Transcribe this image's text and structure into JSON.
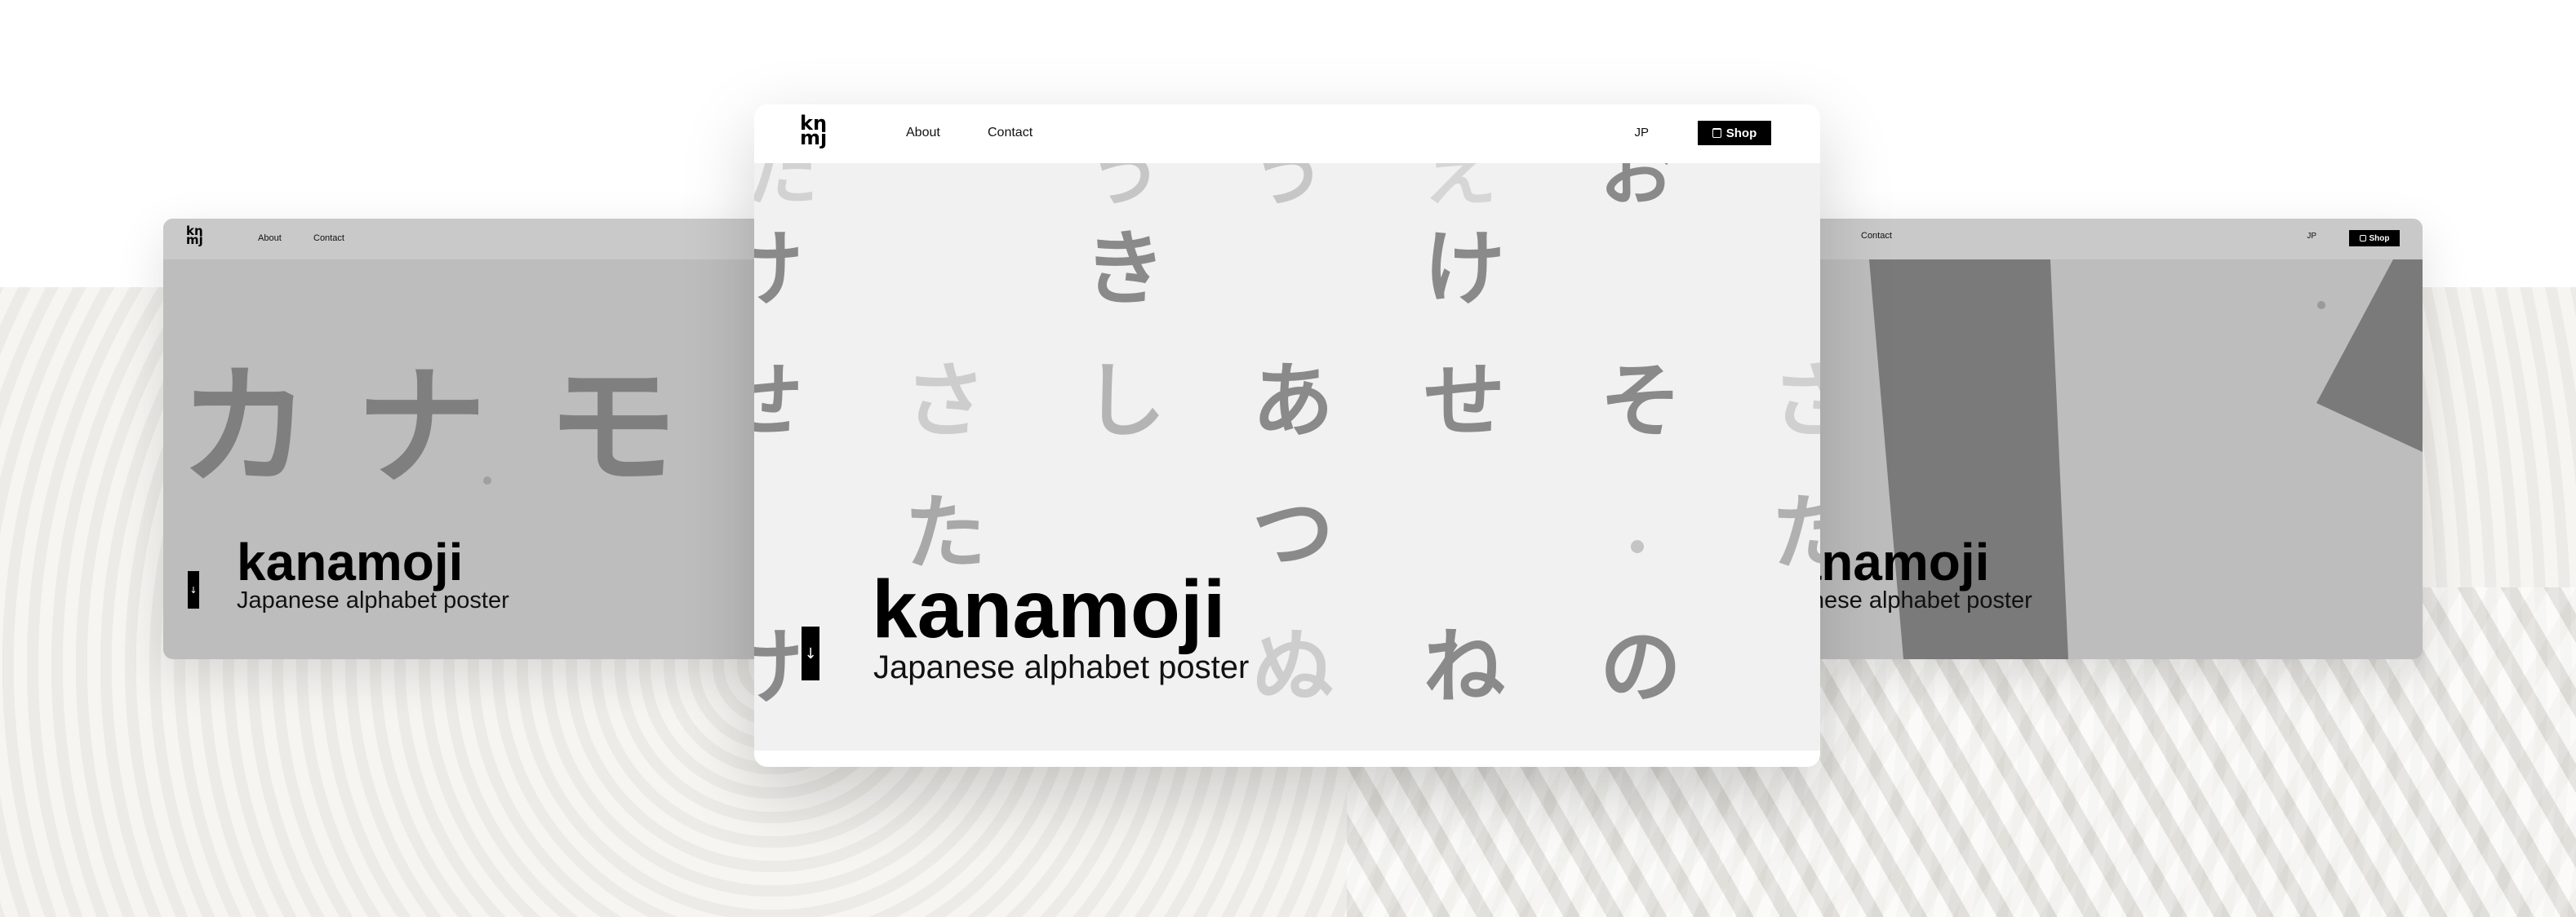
{
  "brand": {
    "logo_top": "kn",
    "logo_bottom": "mj"
  },
  "nav": {
    "about": "About",
    "contact": "Contact",
    "lang": "JP",
    "shop": "Shop"
  },
  "hero": {
    "title": "kanamoji",
    "subtitle": "Japanese alphabet poster"
  },
  "left_window": {
    "kana": [
      "カ",
      "ナ",
      "モ"
    ]
  },
  "center_window": {
    "rows": {
      "row1": [
        "け",
        "き",
        "け"
      ],
      "row2": [
        "せ",
        "さ",
        "し",
        "あ",
        "せ",
        "そ",
        "さ"
      ],
      "row3": [
        "た",
        "つ",
        "た"
      ],
      "row4": [
        "ぬ",
        "ね",
        "の"
      ]
    },
    "faded_top": [
      "た",
      "う",
      "え",
      "お"
    ]
  },
  "colors": {
    "accent": "#000000",
    "gray_window": "#bdbdbd",
    "center_bg": "#f1f1f1",
    "kana_dark": "#7f7f7f",
    "kana_light": "#c9c9c9"
  },
  "icons": {
    "down": "arrow-down-icon",
    "bag": "shopping-bag-icon"
  },
  "down_glyph": "↓"
}
